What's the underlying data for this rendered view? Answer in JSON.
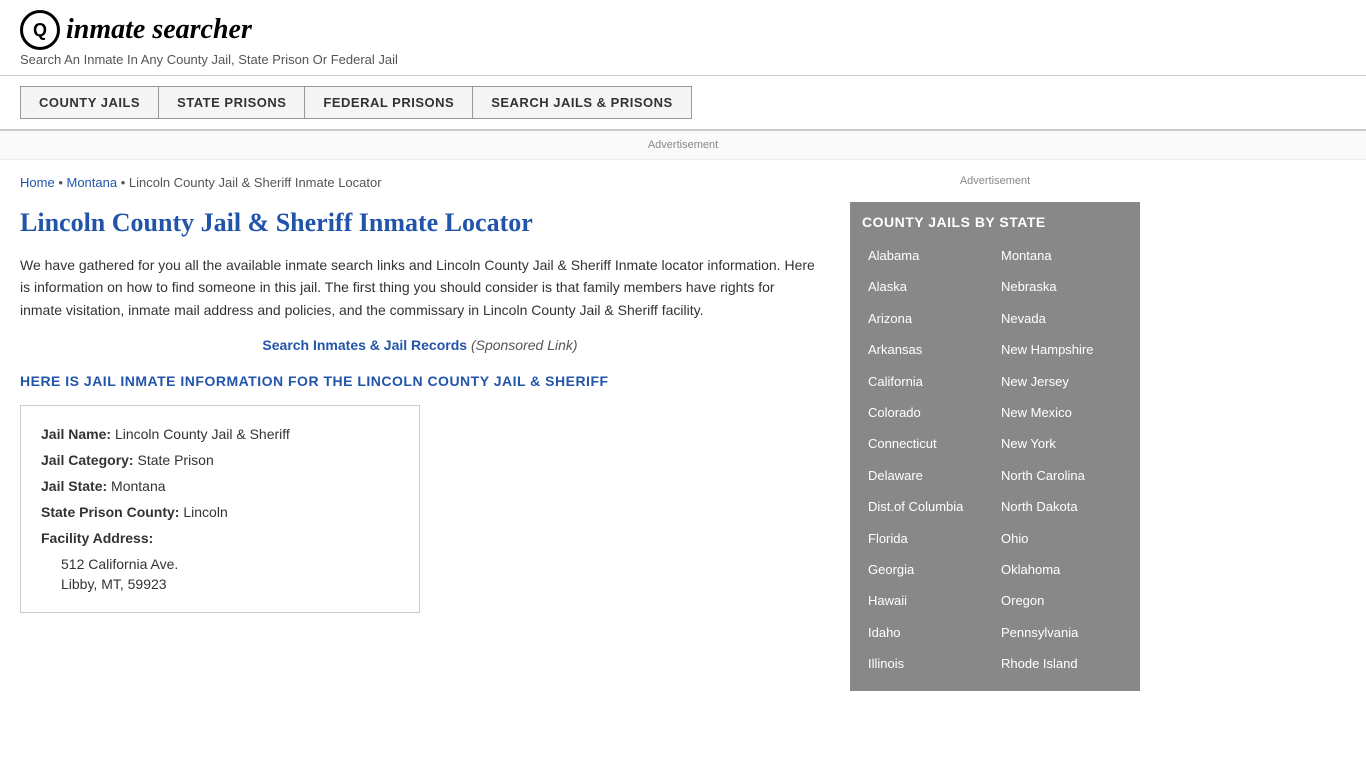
{
  "header": {
    "logo_icon": "Q",
    "logo_text": "inmate searcher",
    "tagline": "Search An Inmate In Any County Jail, State Prison Or Federal Jail"
  },
  "nav": {
    "buttons": [
      {
        "label": "COUNTY JAILS",
        "id": "county-jails"
      },
      {
        "label": "STATE PRISONS",
        "id": "state-prisons"
      },
      {
        "label": "FEDERAL PRISONS",
        "id": "federal-prisons"
      },
      {
        "label": "SEARCH JAILS & PRISONS",
        "id": "search-jails"
      }
    ]
  },
  "ad": {
    "label": "Advertisement"
  },
  "breadcrumb": {
    "home": "Home",
    "state": "Montana",
    "current": "Lincoln County Jail & Sheriff Inmate Locator"
  },
  "page": {
    "title": "Lincoln County Jail & Sheriff Inmate Locator",
    "description": "We have gathered for you all the available inmate search links and Lincoln County Jail & Sheriff Inmate locator information. Here is information on how to find someone in this jail. The first thing you should consider is that family members have rights for inmate visitation, inmate mail address and policies, and the commissary in Lincoln County Jail & Sheriff facility.",
    "sponsored_text": "Search Inmates & Jail Records",
    "sponsored_suffix": "(Sponsored Link)",
    "info_heading": "HERE IS JAIL INMATE INFORMATION FOR THE LINCOLN COUNTY JAIL & SHERIFF",
    "jail_name_label": "Jail Name:",
    "jail_name_value": "Lincoln County Jail & Sheriff",
    "jail_category_label": "Jail Category:",
    "jail_category_value": "State Prison",
    "jail_state_label": "Jail State:",
    "jail_state_value": "Montana",
    "state_prison_county_label": "State Prison County:",
    "state_prison_county_value": "Lincoln",
    "facility_address_label": "Facility Address:",
    "address_line1": "512 California Ave.",
    "address_line2": "Libby, MT, 59923"
  },
  "sidebar": {
    "ad_label": "Advertisement",
    "state_list_title": "COUNTY JAILS BY STATE",
    "states_left": [
      "Alabama",
      "Alaska",
      "Arizona",
      "Arkansas",
      "California",
      "Colorado",
      "Connecticut",
      "Delaware",
      "Dist.of Columbia",
      "Florida",
      "Georgia",
      "Hawaii",
      "Idaho",
      "Illinois"
    ],
    "states_right": [
      "Montana",
      "Nebraska",
      "Nevada",
      "New Hampshire",
      "New Jersey",
      "New Mexico",
      "New York",
      "North Carolina",
      "North Dakota",
      "Ohio",
      "Oklahoma",
      "Oregon",
      "Pennsylvania",
      "Rhode Island"
    ]
  }
}
